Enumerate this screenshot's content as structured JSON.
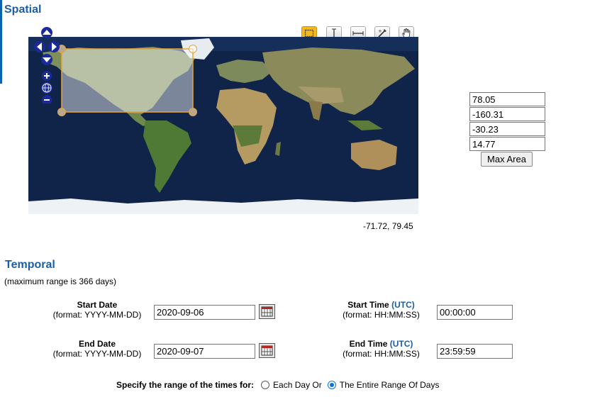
{
  "spatial": {
    "title": "Spatial",
    "coords": {
      "north": "78.05",
      "west": "-160.31",
      "south": "-30.23",
      "east": "14.77"
    },
    "max_area_label": "Max Area",
    "cursor_readout": "-71.72, 79.45",
    "tools": [
      "box-select-icon",
      "vertical-line-icon",
      "horizontal-line-icon",
      "polygon-draw-icon",
      "pan-hand-icon"
    ],
    "active_tool": "box-select-icon"
  },
  "temporal": {
    "title": "Temporal",
    "note": "(maximum range is 366 days)",
    "start_date": {
      "label": "Start Date",
      "format": "(format: YYYY-MM-DD)",
      "value": "2020-09-06"
    },
    "end_date": {
      "label": "End Date",
      "format": "(format: YYYY-MM-DD)",
      "value": "2020-09-07"
    },
    "start_time": {
      "label": "Start Time",
      "utc": "(UTC)",
      "format": "(format: HH:MM:SS)",
      "value": "00:00:00"
    },
    "end_time": {
      "label": "End Time",
      "utc": "(UTC)",
      "format": "(format: HH:MM:SS)",
      "value": "23:59:59"
    },
    "range_question": "Specify the range of the times for:",
    "option_each_day": "Each Day Or",
    "option_entire_range": "The Entire Range Of Days",
    "selected_option": "entire_range"
  }
}
